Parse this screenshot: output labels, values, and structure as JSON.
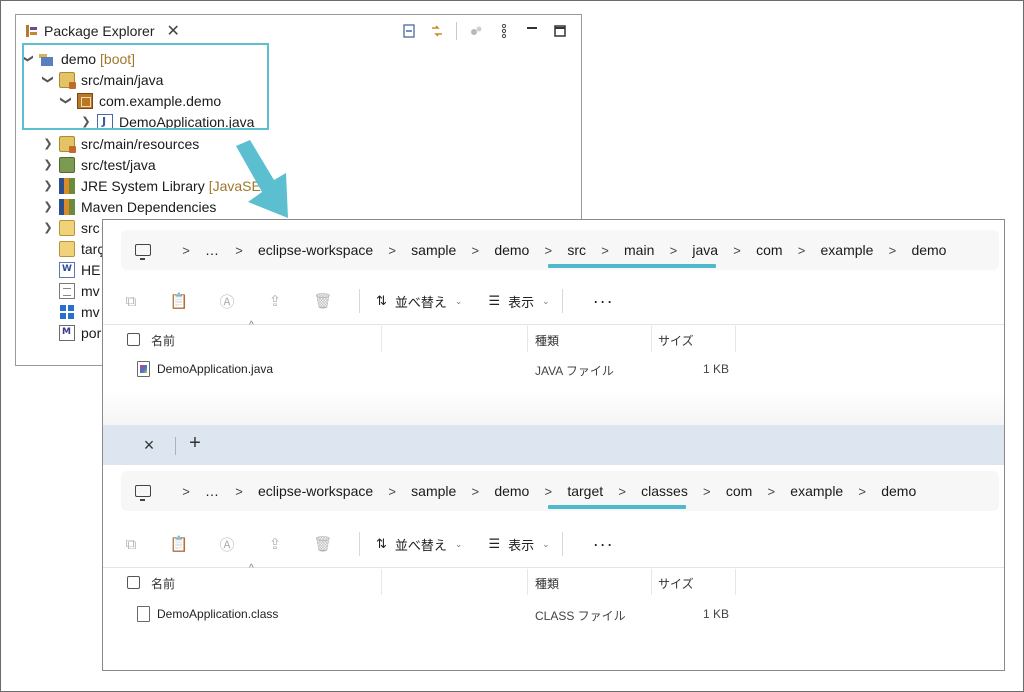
{
  "eclipse": {
    "tab_title": "Package Explorer",
    "tree": [
      {
        "label": "demo",
        "decor": "[boot]",
        "icon": "project-icon"
      },
      {
        "label": "src/main/java",
        "icon": "source-folder-icon"
      },
      {
        "label": "com.example.demo",
        "icon": "package-icon"
      },
      {
        "label": "DemoApplication.java",
        "icon": "java-file-icon"
      },
      {
        "label": "src/main/resources",
        "icon": "source-folder-icon"
      },
      {
        "label": "src/test/java",
        "icon": "test-folder-icon"
      },
      {
        "label": "JRE System Library",
        "decor": "[JavaSE-",
        "icon": "library-icon"
      },
      {
        "label": "Maven Dependencies",
        "icon": "library-icon"
      },
      {
        "label": "src",
        "icon": "folder-icon"
      },
      {
        "label": "tarç",
        "icon": "folder-icon"
      },
      {
        "label": "HE",
        "icon": "word-file-icon"
      },
      {
        "label": "mv",
        "icon": "text-file-icon"
      },
      {
        "label": "mv",
        "icon": "windows-file-icon"
      },
      {
        "label": "por",
        "icon": "maven-file-icon"
      }
    ]
  },
  "explorer": {
    "tab_close": "×",
    "tab_add": "+",
    "top": {
      "breadcrumb": [
        "…",
        "eclipse-workspace",
        "sample",
        "demo",
        "src",
        "main",
        "java",
        "com",
        "example",
        "demo"
      ],
      "file": {
        "name": "DemoApplication.java",
        "type": "JAVA ファイル",
        "size": "1 KB"
      }
    },
    "bottom": {
      "breadcrumb": [
        "…",
        "eclipse-workspace",
        "sample",
        "demo",
        "target",
        "classes",
        "com",
        "example",
        "demo"
      ],
      "file": {
        "name": "DemoApplication.class",
        "type": "CLASS ファイル",
        "size": "1 KB"
      }
    },
    "toolbar": {
      "sort_label": "並べ替え",
      "view_label": "表示",
      "more": "···"
    },
    "columns": {
      "name": "名前",
      "type": "種類",
      "size": "サイズ"
    }
  },
  "colors": {
    "highlight": "#5bbfd0",
    "underline": "#4fb8cc",
    "tab_strip": "#dde5f1"
  }
}
